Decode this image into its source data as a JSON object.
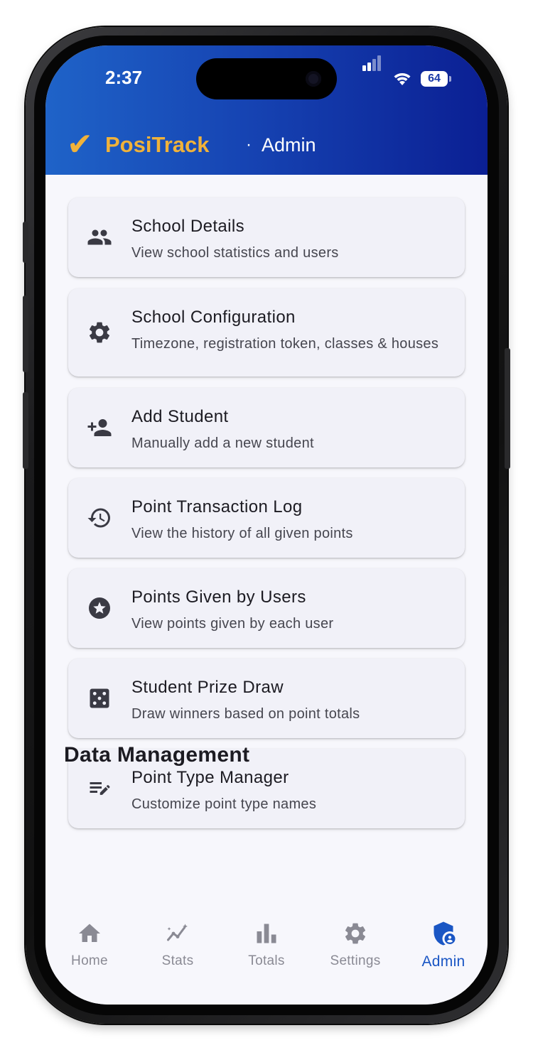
{
  "status_bar": {
    "time": "2:37",
    "battery": "64"
  },
  "header": {
    "logo_check": "✔",
    "logo": "PosiTrack",
    "separator": "·",
    "title": "Admin"
  },
  "admin_items": [
    {
      "title": "School Details",
      "subtitle": "View school statistics and users",
      "icon": "people-icon"
    },
    {
      "title": "School Configuration",
      "subtitle": "Timezone, registration token, classes & houses",
      "icon": "gear-icon"
    },
    {
      "title": "Add Student",
      "subtitle": "Manually add a new student",
      "icon": "person-add-icon"
    },
    {
      "title": "Point Transaction Log",
      "subtitle": "View the history of all given points",
      "icon": "history-icon"
    },
    {
      "title": "Points Given by Users",
      "subtitle": "View points given by each user",
      "icon": "star-circle-icon"
    },
    {
      "title": "Student Prize Draw",
      "subtitle": "Draw winners based on point totals",
      "icon": "dice-icon"
    },
    {
      "title": "Point Type Manager",
      "subtitle": "Customize point type names",
      "icon": "edit-list-icon"
    }
  ],
  "sections": {
    "data_management": "Data Management"
  },
  "tabs": [
    {
      "label": "Home",
      "icon": "home-icon",
      "active": false
    },
    {
      "label": "Stats",
      "icon": "stats-icon",
      "active": false
    },
    {
      "label": "Totals",
      "icon": "bar-chart-icon",
      "active": false
    },
    {
      "label": "Settings",
      "icon": "gear-icon",
      "active": false
    },
    {
      "label": "Admin",
      "icon": "admin-shield-icon",
      "active": true
    }
  ],
  "colors": {
    "header_start": "#1f63c8",
    "header_end": "#0b1f93",
    "brand_gold": "#f0b23a",
    "active_tab": "#1a56c4",
    "inactive_tab": "#8a8a94",
    "card_bg": "#f1f1f8",
    "page_bg": "#f7f7fc"
  }
}
